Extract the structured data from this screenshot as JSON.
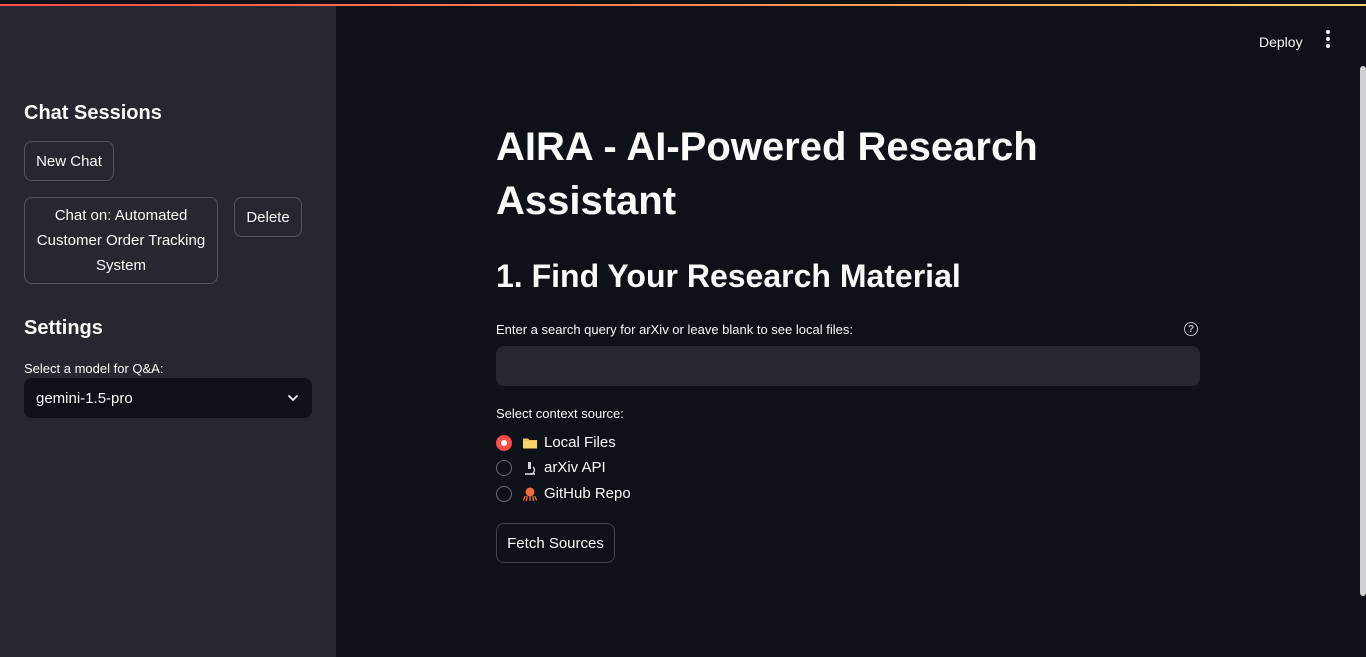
{
  "header": {
    "deploy_label": "Deploy",
    "menu_icon": "more-vertical-icon"
  },
  "sidebar": {
    "sessions_heading": "Chat Sessions",
    "new_chat_label": "New Chat",
    "session_label": "Chat on: Automated Customer Order Tracking System",
    "delete_label": "Delete",
    "settings_heading": "Settings",
    "model_label": "Select a model for Q&A:",
    "model_value": "gemini-1.5-pro"
  },
  "main": {
    "title": "AIRA - AI-Powered Research Assistant",
    "section_heading": "1. Find Your Research Material",
    "search_label": "Enter a search query for arXiv or leave blank to see local files:",
    "search_value": "",
    "context_label": "Select context source:",
    "sources": [
      {
        "label": "Local Files",
        "icon": "folder-icon",
        "selected": true
      },
      {
        "label": "arXiv API",
        "icon": "microscope-icon",
        "selected": false
      },
      {
        "label": "GitHub Repo",
        "icon": "octopus-icon",
        "selected": false
      }
    ],
    "fetch_label": "Fetch Sources"
  },
  "colors": {
    "accent": "#ff4b4b",
    "sidebar_bg": "#262730",
    "main_bg": "#0e1117"
  }
}
